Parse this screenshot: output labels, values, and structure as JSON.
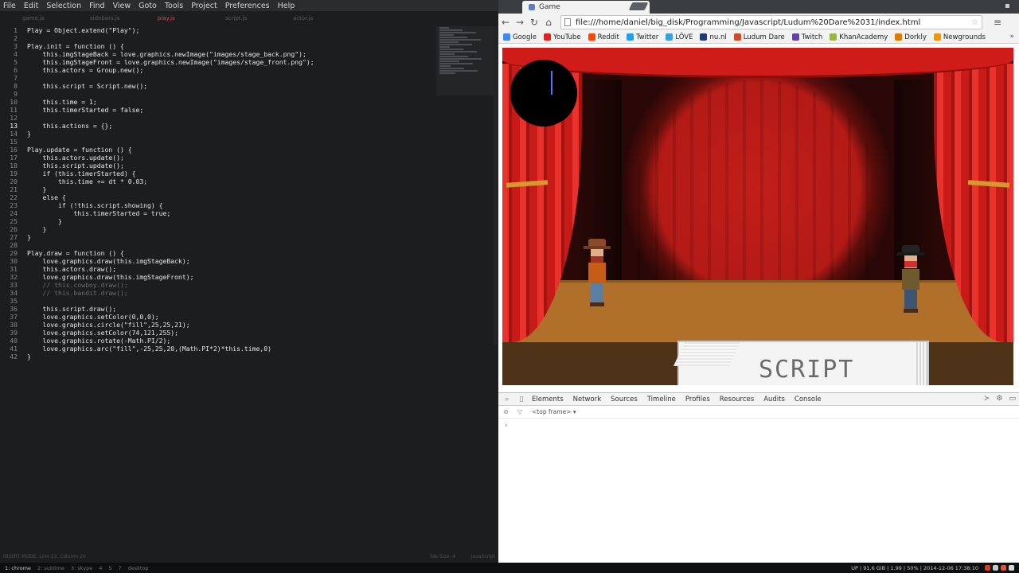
{
  "editor": {
    "menu": [
      "File",
      "Edit",
      "Selection",
      "Find",
      "View",
      "Goto",
      "Tools",
      "Project",
      "Preferences",
      "Help"
    ],
    "tabs": [
      {
        "label": "game.js",
        "active": false
      },
      {
        "label": "sidebars.js",
        "active": false
      },
      {
        "label": "play.js",
        "active": true
      },
      {
        "label": "script.js",
        "active": false
      },
      {
        "label": "actor.js",
        "active": false
      }
    ],
    "lines": [
      {
        "n": "1",
        "text": "Play = Object.extend(\"Play\");"
      },
      {
        "n": "2",
        "text": ""
      },
      {
        "n": "3",
        "text": "Play.init = function () {"
      },
      {
        "n": "4",
        "text": "    this.imgStageBack = love.graphics.newImage(\"images/stage_back.png\");"
      },
      {
        "n": "5",
        "text": "    this.imgStageFront = love.graphics.newImage(\"images/stage_front.png\");"
      },
      {
        "n": "6",
        "text": "    this.actors = Group.new();"
      },
      {
        "n": "7",
        "text": ""
      },
      {
        "n": "8",
        "text": "    this.script = Script.new();"
      },
      {
        "n": "9",
        "text": ""
      },
      {
        "n": "10",
        "text": "    this.time = 1;"
      },
      {
        "n": "11",
        "text": "    this.timerStarted = false;"
      },
      {
        "n": "12",
        "text": ""
      },
      {
        "n": "13",
        "text": "    this.actions = {};"
      },
      {
        "n": "14",
        "text": "}"
      },
      {
        "n": "15",
        "text": ""
      },
      {
        "n": "16",
        "text": "Play.update = function () {"
      },
      {
        "n": "17",
        "text": "    this.actors.update();"
      },
      {
        "n": "18",
        "text": "    this.script.update();"
      },
      {
        "n": "19",
        "text": "    if (this.timerStarted) {"
      },
      {
        "n": "20",
        "text": "        this.time += dt * 0.03;"
      },
      {
        "n": "21",
        "text": "    }"
      },
      {
        "n": "22",
        "text": "    else {"
      },
      {
        "n": "23",
        "text": "        if (!this.script.showing) {"
      },
      {
        "n": "24",
        "text": "            this.timerStarted = true;"
      },
      {
        "n": "25",
        "text": "        }"
      },
      {
        "n": "26",
        "text": "    }"
      },
      {
        "n": "27",
        "text": "}"
      },
      {
        "n": "28",
        "text": ""
      },
      {
        "n": "29",
        "text": "Play.draw = function () {"
      },
      {
        "n": "30",
        "text": "    love.graphics.draw(this.imgStageBack);"
      },
      {
        "n": "31",
        "text": "    this.actors.draw();"
      },
      {
        "n": "32",
        "text": "    love.graphics.draw(this.imgStageFront);"
      },
      {
        "n": "33",
        "text": "    // this.cowboy.draw();"
      },
      {
        "n": "34",
        "text": "    // this.bandit.draw();"
      },
      {
        "n": "35",
        "text": ""
      },
      {
        "n": "36",
        "text": "    this.script.draw();"
      },
      {
        "n": "37",
        "text": "    love.graphics.setColor(0,0,0);"
      },
      {
        "n": "38",
        "text": "    love.graphics.circle(\"fill\",25,25,21);"
      },
      {
        "n": "39",
        "text": "    love.graphics.setColor(74,121,255);"
      },
      {
        "n": "40",
        "text": "    love.graphics.rotate(-Math.PI/2);"
      },
      {
        "n": "41",
        "text": "    love.graphics.arc(\"fill\",-25,25,20,(Math.PI*2)*this.time,0)"
      },
      {
        "n": "42",
        "text": "}"
      }
    ],
    "current_line": "13",
    "status_left": "INSERT MODE, Line 13, Column 20",
    "status_right_1": "Tab Size: 4",
    "status_right_2": "JavaScript"
  },
  "browser": {
    "tab_title": "Game",
    "url": "file:///home/daniel/big_disk/Programming/Javascript/Ludum%20Dare%2031/index.html",
    "bookmarks": [
      {
        "label": "Google",
        "color": "#4285f4"
      },
      {
        "label": "YouTube",
        "color": "#e62117"
      },
      {
        "label": "Reddit",
        "color": "#ff4500"
      },
      {
        "label": "Twitter",
        "color": "#1da1f2"
      },
      {
        "label": "LÖVE",
        "color": "#3aa0e0"
      },
      {
        "label": "nu.nl",
        "color": "#1f3b78"
      },
      {
        "label": "Ludum Dare",
        "color": "#d04a2a"
      },
      {
        "label": "Twitch",
        "color": "#6441a5"
      },
      {
        "label": "KhanAcademy",
        "color": "#9cb443"
      },
      {
        "label": "Dorkly",
        "color": "#e07b00"
      },
      {
        "label": "Newgrounds",
        "color": "#f29500"
      }
    ]
  },
  "game": {
    "script_label": "SCRIPT",
    "timer_color": "#4a79ff"
  },
  "devtools": {
    "tabs": [
      "Elements",
      "Network",
      "Sources",
      "Timeline",
      "Profiles",
      "Resources",
      "Audits",
      "Console"
    ],
    "frame_selector": "<top frame>",
    "prompt": "›"
  },
  "system": {
    "workspaces": [
      "1: chrome",
      "2: sublime",
      "3: skype",
      "4",
      "5",
      "7",
      "desktop"
    ],
    "stats": "UP | 91,6 GiB | 1.99 | 50% | 2014-12-06 17:38:10"
  }
}
